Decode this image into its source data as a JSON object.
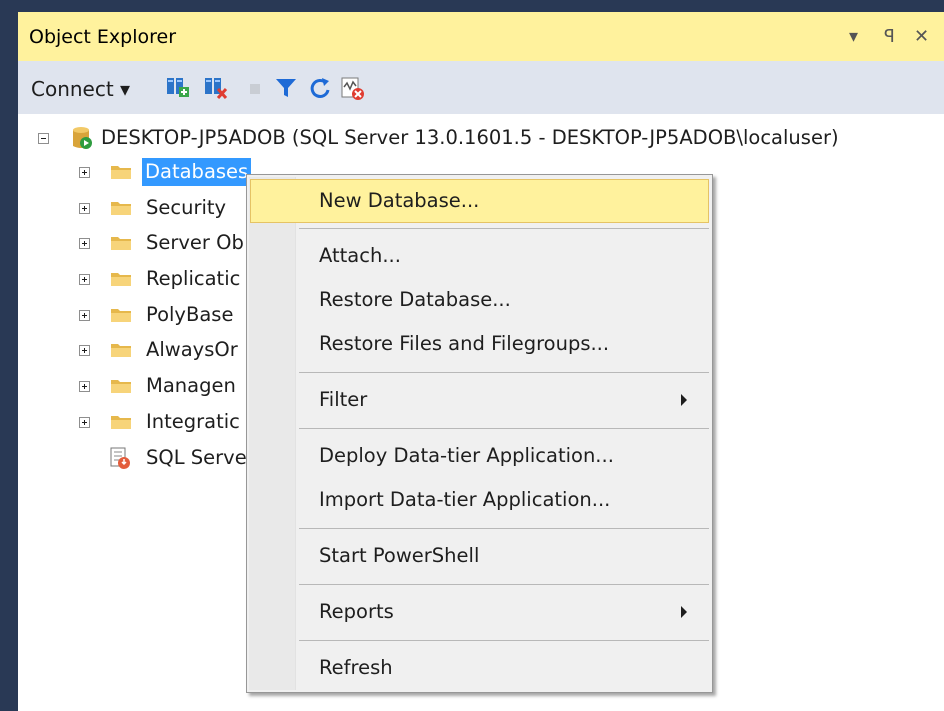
{
  "panel": {
    "title": "Object Explorer",
    "pin_glyph": "▾ ꟼ",
    "close_glyph": "✕"
  },
  "toolbar": {
    "connect_label": "Connect ▾",
    "icons": [
      "connect-object-explorer-icon",
      "disconnect-icon",
      "stop-icon",
      "filter-icon",
      "refresh-icon",
      "activity-monitor-icon"
    ]
  },
  "tree": {
    "server_label": "DESKTOP-JP5ADOB (SQL Server 13.0.1601.5 - DESKTOP-JP5ADOB\\localuser)",
    "items": [
      {
        "label": "Databases"
      },
      {
        "label": "Security"
      },
      {
        "label": "Server Ob"
      },
      {
        "label": "Replicatic"
      },
      {
        "label": "PolyBase"
      },
      {
        "label": "AlwaysOr"
      },
      {
        "label": "Managen"
      },
      {
        "label": "Integratic"
      },
      {
        "label": "SQL Serve"
      }
    ]
  },
  "context_menu": {
    "items": [
      {
        "label": "New Database..."
      },
      {
        "label": "Attach..."
      },
      {
        "label": "Restore Database..."
      },
      {
        "label": "Restore Files and Filegroups..."
      },
      {
        "label": "Filter"
      },
      {
        "label": "Deploy Data-tier Application..."
      },
      {
        "label": "Import Data-tier Application..."
      },
      {
        "label": "Start PowerShell"
      },
      {
        "label": "Reports"
      },
      {
        "label": "Refresh"
      }
    ]
  },
  "colors": {
    "title_bar": "#fff29d",
    "toolbar": "#dfe4ee",
    "selection": "#3399ff",
    "menu_highlight": "#fff29d",
    "window_frame": "#293955"
  }
}
